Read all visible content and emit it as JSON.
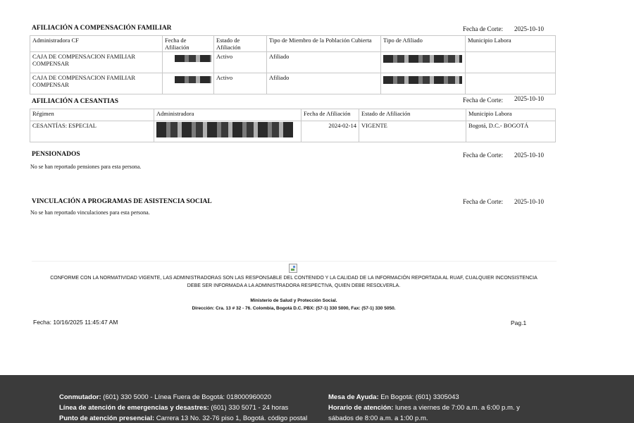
{
  "comp": {
    "title": "AFILIACIÓN A COMPENSACIÓN FAMILIAR",
    "fecha_label": "Fecha de Corte:",
    "fecha_value": "2025-10-10",
    "headers": [
      "Administradora CF",
      "Fecha de Afiliación",
      "Estado de Afiliación",
      "Tipo de Miembro de la Población Cubierta",
      "Tipo de Afiliado",
      "Municipio Labora"
    ],
    "rows": [
      {
        "admin": "CAJA DE COMPENSACION FAMILIAR COMPENSAR",
        "estado": "Activo",
        "tipo_miembro": "Afiliado"
      },
      {
        "admin": "CAJA DE COMPENSACION FAMILIAR COMPENSAR",
        "estado": "Activo",
        "tipo_miembro": "Afiliado"
      }
    ]
  },
  "ces": {
    "title": "AFILIACIÓN A CESANTIAS",
    "fecha_label": "Fecha de Corte:",
    "fecha_value": "2025-10-10",
    "headers": [
      "Régimen",
      "Administradora",
      "Fecha de Afiliación",
      "Estado de Afiliación",
      "Municipio Labora"
    ],
    "row": {
      "regimen": "CESANTÍAS: ESPECIAL",
      "fecha": "2024-02-14",
      "estado": "VIGENTE",
      "municipio": "Bogotá, D.C.- BOGOTÁ"
    }
  },
  "pens": {
    "title": "PENSIONADOS",
    "fecha_label": "Fecha de Corte:",
    "fecha_value": "2025-10-10",
    "note": "No se han reportado pensiones para esta persona."
  },
  "vinc": {
    "title": "VINCULACIÓN A PROGRAMAS DE  ASISTENCIA SOCIAL",
    "fecha_label": "Fecha de Corte:",
    "fecha_value": "2025-10-10",
    "note": "No se han reportado vinculaciones para esta persona."
  },
  "legal": {
    "line1": "CONFORME CON LA NORMATIVIDAD VIGENTE, LAS ADMINISTRADORAS SON LAS RESPONSABLE DEL CONTENIDO Y LA CALIDAD DE LA INFORMACIÓN REPORTADA AL RUAF, CUALQUIER INCONSISTENCIA",
    "line2": "DEBE SER INFORMADA A LA ADMINISTRADORA RESPECTIVA, QUIEN DEBE RESOLVERLA.",
    "ministry": "Ministerio de Salud y Protección Social.",
    "address": "Dirección: Cra. 13 # 32 - 76. Colombia, Bogotá D.C. PBX: (57-1) 330 5000, Fax: (57-1) 330 5050."
  },
  "print": {
    "fecha": "Fecha: 10/16/2025 11:45:47 AM",
    "page": "Pag.1"
  },
  "footer": {
    "l1_label": "Conmutador:",
    "l1_text": " (601) 330 5000 - Línea Fuera de Bogotá: 018000960020",
    "l2_label": "Línea de atención de emergencias y desastres:",
    "l2_text": " (601) 330 5071 - 24 horas",
    "l3_label": "Punto de atención presencial:",
    "l3_text": " Carrera 13 No. 32-76 piso 1, Bogotá. código postal",
    "r1_label": "Mesa de Ayuda:",
    "r1_text": " En Bogotá: (601) 3305043",
    "r2_label": "Horario de atención:",
    "r2_text": " lunes a viernes de 7:00 a.m. a 6:00 p.m. y",
    "r3_text": "sábados de 8:00 a.m. a 1:00 p.m."
  }
}
